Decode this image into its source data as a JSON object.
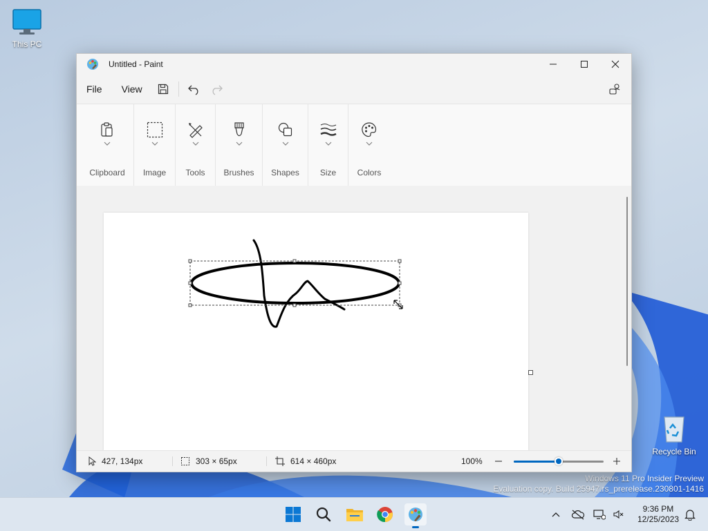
{
  "desktop": {
    "icons": [
      {
        "label": "This PC"
      },
      {
        "label": "Recycle Bin"
      }
    ],
    "watermark": {
      "line1": "Windows 11 Pro Insider Preview",
      "line2": "Evaluation copy. Build 25947.rs_prerelease.230801-1416"
    }
  },
  "window": {
    "title": "Untitled - Paint",
    "menu": {
      "file": "File",
      "view": "View"
    },
    "ribbon": {
      "groups": [
        {
          "label": "Clipboard",
          "icon": "clipboard-icon"
        },
        {
          "label": "Image",
          "icon": "selection-icon"
        },
        {
          "label": "Tools",
          "icon": "tools-icon"
        },
        {
          "label": "Brushes",
          "icon": "brush-icon"
        },
        {
          "label": "Shapes",
          "icon": "shapes-icon"
        },
        {
          "label": "Size",
          "icon": "size-icon"
        },
        {
          "label": "Colors",
          "icon": "palette-icon"
        }
      ]
    },
    "status": {
      "cursor": "427, 134px",
      "selection": "303 × 65px",
      "canvas_size": "614 × 460px",
      "zoom": "100%",
      "zoom_level": 0.5
    }
  },
  "taskbar": {
    "apps": [
      "start-icon",
      "search-icon",
      "file-explorer-icon",
      "chrome-icon",
      "paint-icon"
    ],
    "clock": {
      "time": "9:36 PM",
      "date": "12/25/2023"
    }
  },
  "colors": {
    "accent": "#0067c0",
    "stroke": "#000000",
    "desktop_bg": "#c4d3e4"
  }
}
